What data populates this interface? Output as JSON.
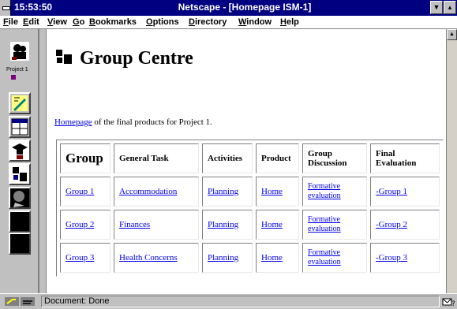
{
  "window": {
    "time": "15:53:50",
    "title": "Netscape - [Homepage ISM-1]"
  },
  "menu": [
    "File",
    "Edit",
    "View",
    "Go",
    "Bookmarks",
    "Options",
    "Directory",
    "Window",
    "Help"
  ],
  "sidebar": {
    "label": "Project 1",
    "icons": [
      "student-icon",
      "writing-icon",
      "window-icon",
      "graduate-icon",
      "group-centre-icon",
      "face-icon",
      "screen-icon"
    ]
  },
  "page": {
    "heading": "Group Centre",
    "intro_link": "Homepage",
    "intro_text": " of the final products for Project 1."
  },
  "table": {
    "headers": [
      "Group",
      "General Task",
      "Activities",
      "Product",
      "Group Discussion",
      "Final Evaluation"
    ],
    "rows": [
      [
        "Group 1",
        "Accommodation",
        "Planning",
        "Home",
        "Formative evaluation",
        "-Group 1"
      ],
      [
        "Group 2",
        "Finances",
        "Planning",
        "Home",
        "Formative evaluation",
        "-Group 2"
      ],
      [
        "Group 3",
        "Health Concerns",
        "Planning",
        "Home",
        "Formative evaluation",
        "-Group 3"
      ]
    ]
  },
  "status": {
    "text": "Document: Done"
  }
}
